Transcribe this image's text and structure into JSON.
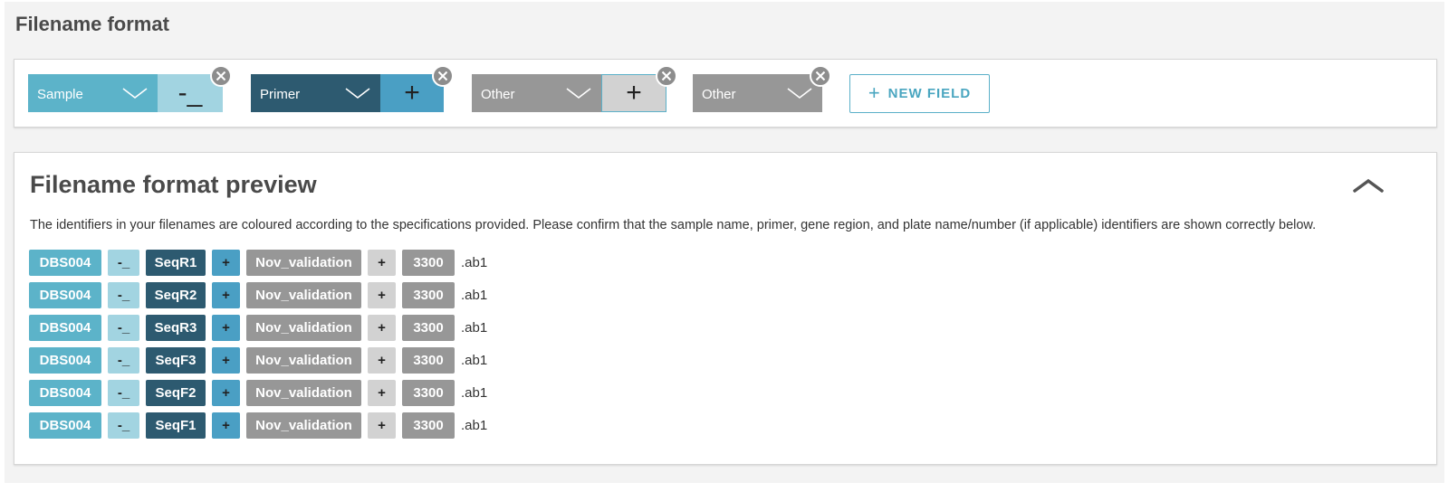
{
  "section": {
    "title": "Filename format"
  },
  "colors": {
    "sample": "#5cb3c9",
    "sample_sep": "#a2d4e1",
    "primer": "#2d5a70",
    "primer_sep": "#4a9fc4",
    "other": "#979797",
    "other_sep": "#d2d2d2",
    "new_field": "#4aa6c0"
  },
  "fields": [
    {
      "label": "Sample",
      "separator": "-_"
    },
    {
      "label": "Primer",
      "separator": "+"
    },
    {
      "label": "Other",
      "separator": "+"
    },
    {
      "label": "Other",
      "separator": ""
    }
  ],
  "new_field_label": "NEW FIELD",
  "preview": {
    "title": "Filename format preview",
    "description": "The identifiers in your filenames are coloured according to the specifications provided. Please confirm that the sample name, primer, gene region, and plate name/number (if applicable) identifiers are shown correctly below.",
    "rows": [
      {
        "sample": "DBS004",
        "sep1": "-_",
        "primer": "SeqR1",
        "sep2": "+",
        "other1": "Nov_validation",
        "sep3": "+",
        "other2": "3300",
        "ext": ".ab1"
      },
      {
        "sample": "DBS004",
        "sep1": "-_",
        "primer": "SeqR2",
        "sep2": "+",
        "other1": "Nov_validation",
        "sep3": "+",
        "other2": "3300",
        "ext": ".ab1"
      },
      {
        "sample": "DBS004",
        "sep1": "-_",
        "primer": "SeqR3",
        "sep2": "+",
        "other1": "Nov_validation",
        "sep3": "+",
        "other2": "3300",
        "ext": ".ab1"
      },
      {
        "sample": "DBS004",
        "sep1": "-_",
        "primer": "SeqF3",
        "sep2": "+",
        "other1": "Nov_validation",
        "sep3": "+",
        "other2": "3300",
        "ext": ".ab1"
      },
      {
        "sample": "DBS004",
        "sep1": "-_",
        "primer": "SeqF2",
        "sep2": "+",
        "other1": "Nov_validation",
        "sep3": "+",
        "other2": "3300",
        "ext": ".ab1"
      },
      {
        "sample": "DBS004",
        "sep1": "-_",
        "primer": "SeqF1",
        "sep2": "+",
        "other1": "Nov_validation",
        "sep3": "+",
        "other2": "3300",
        "ext": ".ab1"
      }
    ]
  }
}
